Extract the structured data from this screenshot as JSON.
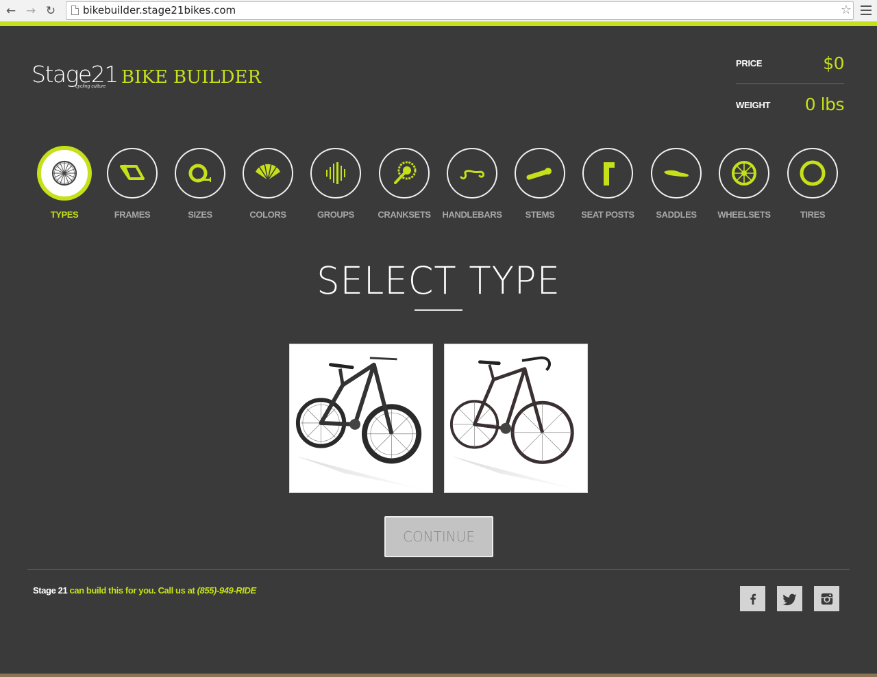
{
  "browser": {
    "url": "bikebuilder.stage21bikes.com"
  },
  "header": {
    "logo_text": "Stage21",
    "logo_tagline": "cycling culture",
    "app_title": "BIKE BUILDER",
    "price_label": "PRICE",
    "price_value": "$0",
    "weight_label": "WEIGHT",
    "weight_value": "0 lbs"
  },
  "steps": [
    {
      "label": "TYPES",
      "icon": "wheel-icon",
      "active": true
    },
    {
      "label": "FRAMES",
      "icon": "frame-icon",
      "active": false
    },
    {
      "label": "SIZES",
      "icon": "tape-measure-icon",
      "active": false
    },
    {
      "label": "COLORS",
      "icon": "color-fan-icon",
      "active": false
    },
    {
      "label": "GROUPS",
      "icon": "groupset-icon",
      "active": false
    },
    {
      "label": "CRANKSETS",
      "icon": "crankset-icon",
      "active": false
    },
    {
      "label": "HANDLEBARS",
      "icon": "handlebar-icon",
      "active": false
    },
    {
      "label": "STEMS",
      "icon": "stem-icon",
      "active": false
    },
    {
      "label": "SEAT POSTS",
      "icon": "seat-post-icon",
      "active": false
    },
    {
      "label": "SADDLES",
      "icon": "saddle-icon",
      "active": false
    },
    {
      "label": "WHEELSETS",
      "icon": "wheelset-icon",
      "active": false
    },
    {
      "label": "TIRES",
      "icon": "tire-icon",
      "active": false
    }
  ],
  "main": {
    "heading": "SELECT TYPE",
    "options": [
      {
        "type": "mountain-bike"
      },
      {
        "type": "road-bike"
      }
    ],
    "continue_label": "CONTINUE"
  },
  "footer": {
    "brand": "Stage 21",
    "message": "can build this for you. Call us at",
    "phone": "(855)-949-RIDE",
    "social": [
      "facebook-icon",
      "twitter-icon",
      "instagram-icon"
    ]
  },
  "colors": {
    "accent": "#c6e019",
    "background": "#3a3a3a"
  }
}
